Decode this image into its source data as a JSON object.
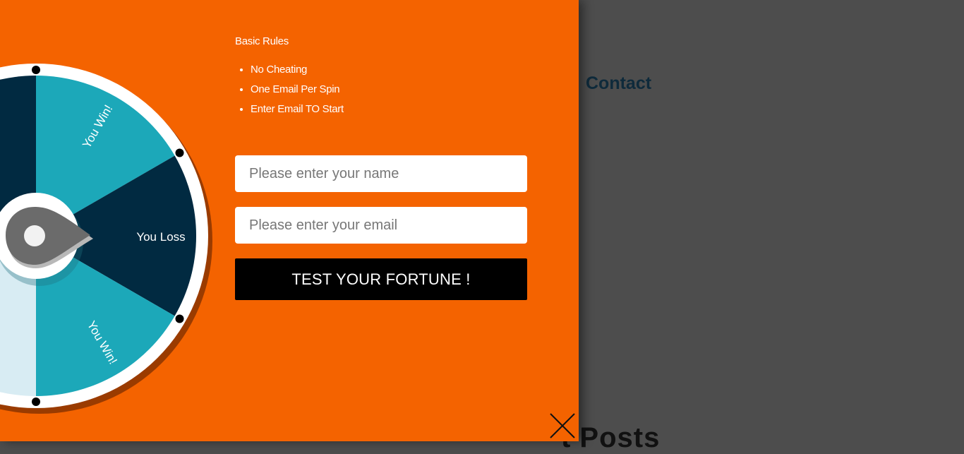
{
  "background": {
    "nav_contact": "Contact",
    "section_heading_fragment": "t Posts"
  },
  "wheel": {
    "slices": [
      {
        "label": "You Win!",
        "color": "#1ca8b9"
      },
      {
        "label": "You Loss",
        "color": "#012a41"
      },
      {
        "label": "You Win!",
        "color": "#1ca8b9"
      }
    ],
    "other_colors": {
      "dark": "#012a41",
      "light": "#d8ecf3",
      "rim": "#ffffff",
      "shadow": "#9a3b00"
    },
    "pointer_color": "#6b6b6b"
  },
  "rules": {
    "title": "Basic Rules",
    "items": [
      "No Cheating",
      "One Email Per Spin",
      "Enter Email TO Start"
    ]
  },
  "form": {
    "name_placeholder": "Please enter your name",
    "email_placeholder": "Please enter your email",
    "submit_label": "TEST YOUR FORTUNE !"
  },
  "colors": {
    "panel": "#f46300",
    "overlay": "#4d4d4d",
    "button": "#000000"
  },
  "icons": {
    "close": "close-icon"
  }
}
